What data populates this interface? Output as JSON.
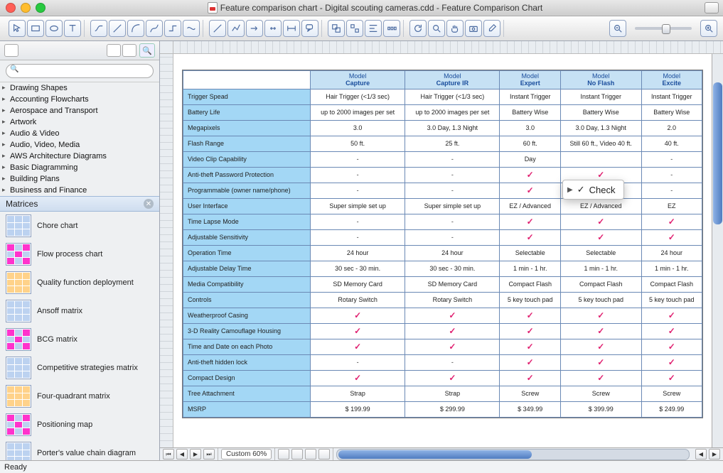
{
  "title": "Feature comparison chart - Digital scouting cameras.cdd - Feature Comparison Chart",
  "popup_label": "Check",
  "sidebar": {
    "search_placeholder": "",
    "tree": [
      "Drawing Shapes",
      "Accounting Flowcharts",
      "Aerospace and Transport",
      "Artwork",
      "Audio & Video",
      "Audio, Video, Media",
      "AWS Architecture Diagrams",
      "Basic Diagramming",
      "Building Plans",
      "Business and Finance"
    ],
    "category": "Matrices",
    "shapes": [
      "Chore chart",
      "Flow process chart",
      "Quality function deployment",
      "Ansoff matrix",
      "BCG matrix",
      "Competitive strategies matrix",
      "Four-quadrant matrix",
      "Positioning map",
      "Porter's value chain diagram"
    ]
  },
  "bottom": {
    "zoom": "Custom 60%"
  },
  "status": "Ready",
  "chart_data": {
    "type": "table",
    "title": "Feature Comparison Chart",
    "columns": [
      {
        "top": "Model",
        "bottom": "Capture"
      },
      {
        "top": "Model",
        "bottom": "Capture IR"
      },
      {
        "top": "Model",
        "bottom": "Expert"
      },
      {
        "top": "Model",
        "bottom": "No Flash"
      },
      {
        "top": "Model",
        "bottom": "Excite"
      }
    ],
    "rows": [
      {
        "feature": "Trigger Spead",
        "values": [
          "Hair Trigger (<1/3 sec)",
          "Hair Trigger (<1/3 sec)",
          "Instant Trigger",
          "Instant Trigger",
          "Instant Trigger"
        ]
      },
      {
        "feature": "Battery Life",
        "values": [
          "up to 2000 images per set",
          "up to 2000 images per set",
          "Battery Wise",
          "Battery Wise",
          "Battery Wise"
        ]
      },
      {
        "feature": "Megapixels",
        "values": [
          "3.0",
          "3.0 Day, 1.3 Night",
          "3.0",
          "3.0 Day, 1.3 Night",
          "2.0"
        ]
      },
      {
        "feature": "Flash Range",
        "values": [
          "50 ft.",
          "25 ft.",
          "60 ft.",
          "Still 60 ft., Video 40 ft.",
          "40 ft."
        ]
      },
      {
        "feature": "Video Clip Capability",
        "values": [
          "-",
          "-",
          "Day",
          "",
          "-"
        ]
      },
      {
        "feature": "Anti-theft Password Protection",
        "values": [
          "-",
          "-",
          "✓",
          "✓",
          "-"
        ]
      },
      {
        "feature": "Programmable (owner name/phone)",
        "values": [
          "-",
          "-",
          "✓",
          "✓",
          "-"
        ]
      },
      {
        "feature": "User Interface",
        "values": [
          "Super simple set up",
          "Super simple set up",
          "EZ / Advanced",
          "EZ / Advanced",
          "EZ"
        ]
      },
      {
        "feature": "Time Lapse Mode",
        "values": [
          "-",
          "-",
          "✓",
          "✓",
          "✓"
        ]
      },
      {
        "feature": "Adjustable Sensitivity",
        "values": [
          "-",
          "-",
          "✓",
          "✓",
          "✓"
        ]
      },
      {
        "feature": "Operation Time",
        "values": [
          "24 hour",
          "24 hour",
          "Selectable",
          "Selectable",
          "24 hour"
        ]
      },
      {
        "feature": "Adjustable Delay Time",
        "values": [
          "30 sec - 30 min.",
          "30 sec - 30 min.",
          "1 min - 1 hr.",
          "1 min - 1 hr.",
          "1 min - 1 hr."
        ]
      },
      {
        "feature": "Media Compatibility",
        "values": [
          "SD Memory Card",
          "SD Memory Card",
          "Compact Flash",
          "Compact Flash",
          "Compact Flash"
        ]
      },
      {
        "feature": "Controls",
        "values": [
          "Rotary Switch",
          "Rotary Switch",
          "5 key touch pad",
          "5 key touch pad",
          "5 key touch pad"
        ]
      },
      {
        "feature": "Weatherproof Casing",
        "values": [
          "✓",
          "✓",
          "✓",
          "✓",
          "✓"
        ]
      },
      {
        "feature": "3-D Reality Camouflage Housing",
        "values": [
          "✓",
          "✓",
          "✓",
          "✓",
          "✓"
        ]
      },
      {
        "feature": "Time and Date on each Photo",
        "values": [
          "✓",
          "✓",
          "✓",
          "✓",
          "✓"
        ]
      },
      {
        "feature": "Anti-theft hidden lock",
        "values": [
          "-",
          "-",
          "✓",
          "✓",
          "✓"
        ]
      },
      {
        "feature": "Compact Design",
        "values": [
          "✓",
          "✓",
          "✓",
          "✓",
          "✓"
        ]
      },
      {
        "feature": "Tree Attachment",
        "values": [
          "Strap",
          "Strap",
          "Screw",
          "Screw",
          "Screw"
        ]
      },
      {
        "feature": "MSRP",
        "values": [
          "$ 199.99",
          "$ 299.99",
          "$ 349.99",
          "$ 399.99",
          "$ 249.99"
        ]
      }
    ]
  }
}
